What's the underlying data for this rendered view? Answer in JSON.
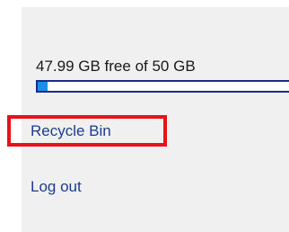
{
  "storage": {
    "label": "47.99 GB free of 50 GB",
    "used_fraction": 0.0402,
    "bar_color": "#1e8fe6",
    "border_color": "#1c2a8a"
  },
  "links": {
    "recycle_bin": "Recycle Bin",
    "log_out": "Log out"
  },
  "colors": {
    "link": "#1a3d8f",
    "highlight": "#e8121a",
    "panel_bg": "#f0f0f0"
  }
}
